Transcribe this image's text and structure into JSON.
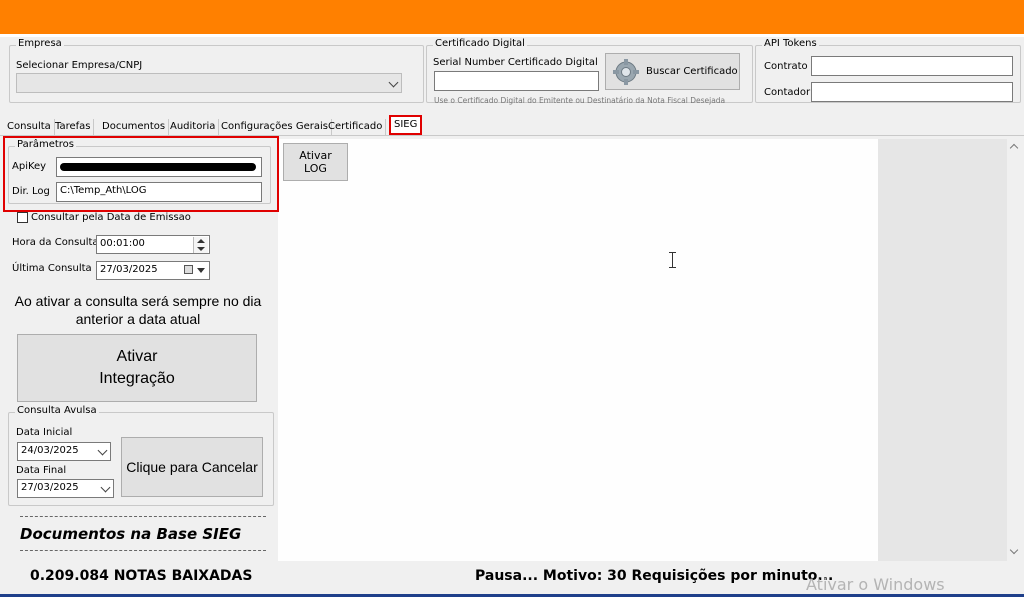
{
  "empresa": {
    "legend": "Empresa",
    "label": "Selecionar Empresa/CNPJ",
    "select_value": ""
  },
  "certificado": {
    "legend": "Certificado Digital",
    "serial_label": "Serial Number Certificado Digital",
    "serial_value": "",
    "buscar_button": "Buscar Certificado",
    "hint": "Use o Certificado Digital do Emitente ou Destinatário da Nota Fiscal Desejada"
  },
  "api_tokens": {
    "legend": "API Tokens",
    "contrato_label": "Contrato",
    "contrato_value": "",
    "contador_label": "Contador",
    "contador_value": ""
  },
  "tabs": [
    {
      "label": "Consulta"
    },
    {
      "label": "Tarefas"
    },
    {
      "label": "Documentos"
    },
    {
      "label": "Auditoria"
    },
    {
      "label": "Configurações Gerais"
    },
    {
      "label": "Certificado"
    },
    {
      "label": "SIEG"
    }
  ],
  "parametros": {
    "legend": "Parâmetros",
    "apikey_label": "ApiKey",
    "dirlog_label": "Dir. Log",
    "dirlog_value": "C:\\Temp_Ath\\LOG"
  },
  "ativar_log_button": "Ativar\nLOG",
  "consultar_emissao_label": "Consultar pela Data de Emissao",
  "hora_consulta": {
    "label": "Hora da Consulta",
    "value": "00:01:00"
  },
  "ultima_consulta": {
    "label": "Última Consulta",
    "value": "27/03/2025"
  },
  "info_text": "Ao ativar a consulta será sempre no dia anterior a data atual",
  "ativar_integracao_button": "Ativar\nIntegração",
  "consulta_avulsa": {
    "legend": "Consulta Avulsa",
    "data_inicial_label": "Data Inicial",
    "data_inicial_value": "24/03/2025",
    "data_final_label": "Data Final",
    "data_final_value": "27/03/2025",
    "cancelar_button": "Clique para Cancelar"
  },
  "documentos_title": "Documentos na Base SIEG",
  "status": {
    "notas": "0.209.084 NOTAS BAIXADAS",
    "pausa": "Pausa... Motivo: 30 Requisições por minuto...",
    "watermark": "Ativar o Windows"
  }
}
